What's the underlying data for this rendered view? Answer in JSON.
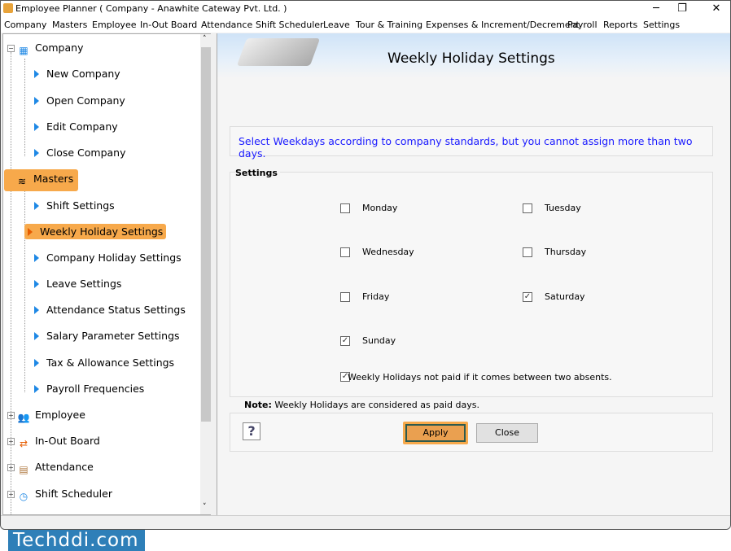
{
  "title": "Employee Planner ( Company - Anawhite Cateway Pvt. Ltd. )",
  "menu": [
    "Company",
    "Masters",
    "Employee",
    "In-Out Board",
    "Attendance",
    "Shift Scheduler",
    "Leave",
    "Tour & Training",
    "Expenses & Increment/Decrement",
    "Payroll",
    "Reports",
    "Settings"
  ],
  "tree": {
    "company": "Company",
    "company_items": [
      "New Company",
      "Open Company",
      "Edit Company",
      "Close Company"
    ],
    "masters": "Masters",
    "masters_items": [
      "Shift Settings",
      "Weekly Holiday Settings",
      "Company Holiday Settings",
      "Leave Settings",
      "Attendance Status Settings",
      "Salary Parameter Settings",
      "Tax & Allowance Settings",
      "Payroll Frequencies"
    ],
    "others": [
      "Employee",
      "In-Out Board",
      "Attendance",
      "Shift Scheduler"
    ],
    "selected": "Weekly Holiday Settings"
  },
  "page": {
    "title": "Weekly Holiday Settings",
    "info": "Select Weekdays according to company standards, but you cannot assign more than two days.",
    "group": "Settings",
    "days": [
      {
        "label": "Monday",
        "checked": false
      },
      {
        "label": "Tuesday",
        "checked": false
      },
      {
        "label": "Wednesday",
        "checked": false
      },
      {
        "label": "Thursday",
        "checked": false
      },
      {
        "label": "Friday",
        "checked": false
      },
      {
        "label": "Saturday",
        "checked": true
      },
      {
        "label": "Sunday",
        "checked": true
      }
    ],
    "not_paid": {
      "label": "Weekly Holidays not paid if it comes between two absents.",
      "checked": true
    },
    "note_label": "Note:",
    "note": "Weekly Holidays are considered as paid days.",
    "apply": "Apply",
    "close": "Close",
    "help": "?"
  },
  "watermark": "Techddi.com",
  "colors": {
    "accent": "#f7a94b",
    "info_text": "#1a1aff",
    "watermark_bg": "#2e7fb8"
  }
}
